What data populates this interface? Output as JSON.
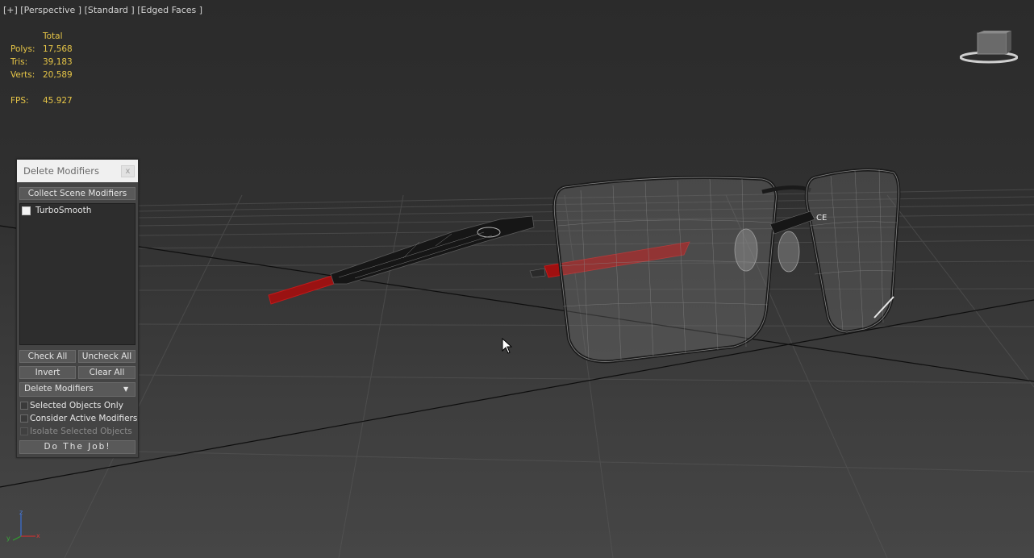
{
  "viewport": {
    "label": "[+] [Perspective ] [Standard ] [Edged Faces ]"
  },
  "stats": {
    "header": "Total",
    "rows": [
      {
        "label": "Polys:",
        "value": "17,568"
      },
      {
        "label": "Tris:",
        "value": "39,183"
      },
      {
        "label": "Verts:",
        "value": "20,589"
      }
    ],
    "fps_label": "FPS:",
    "fps_value": "45.927"
  },
  "icons": {
    "viewcube": "viewcube-icon",
    "axis": "axis-tripod-icon",
    "cursor": "mouse-cursor-icon",
    "close": "close-icon",
    "dropdown": "chevron-down-icon"
  },
  "panel": {
    "title": "Delete Modifiers",
    "close_label": "x",
    "collect_button": "Collect Scene Modifiers",
    "modifiers": [
      {
        "label": "TurboSmooth",
        "checked": false
      }
    ],
    "check_all": "Check All",
    "uncheck_all": "Uncheck All",
    "invert": "Invert",
    "clear_all": "Clear All",
    "mode_select": "Delete Modifiers",
    "options": {
      "selected_only": "Selected Objects Only",
      "consider_active": "Consider Active Modifiers",
      "isolate_selected": "Isolate Selected Objects"
    },
    "do_job": "Do The Job!"
  },
  "colors": {
    "stats_text": "#e6c547",
    "accent_red": "#b41414",
    "panel_bg": "#444444"
  }
}
